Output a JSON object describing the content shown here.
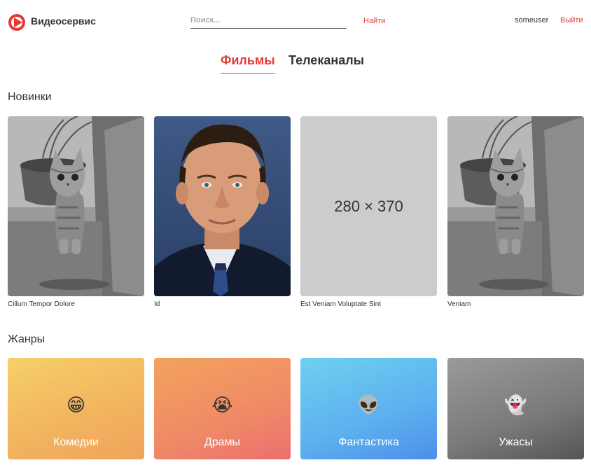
{
  "header": {
    "brand": "Видеосервис",
    "search_placeholder": "Поиск...",
    "search_value": "",
    "find_label": "Найти",
    "username": "someuser",
    "logout_label": "Выйти",
    "accent_color": "#e53935"
  },
  "tabs": [
    {
      "label": "Фильмы",
      "active": true
    },
    {
      "label": "Телеканалы",
      "active": false
    }
  ],
  "new_section": {
    "title": "Новинки",
    "items": [
      {
        "title": "Cillum Tempor Dolore",
        "image": "cat-photo"
      },
      {
        "title": "Id",
        "image": "man-portrait-photo"
      },
      {
        "title": "Est Veniam Voluptate Sint",
        "image": "placeholder",
        "placeholder_text": "280 × 370"
      },
      {
        "title": "Veniam",
        "image": "cat-photo"
      }
    ]
  },
  "genres_section": {
    "title": "Жанры",
    "items": [
      {
        "label": "Комедии",
        "emoji": "😁",
        "icon": "grinning-face-icon"
      },
      {
        "label": "Драмы",
        "emoji": "😭",
        "icon": "crying-face-icon"
      },
      {
        "label": "Фантастика",
        "emoji": "👽",
        "icon": "alien-icon"
      },
      {
        "label": "Ужасы",
        "emoji": "👻",
        "icon": "ghost-icon"
      }
    ]
  }
}
